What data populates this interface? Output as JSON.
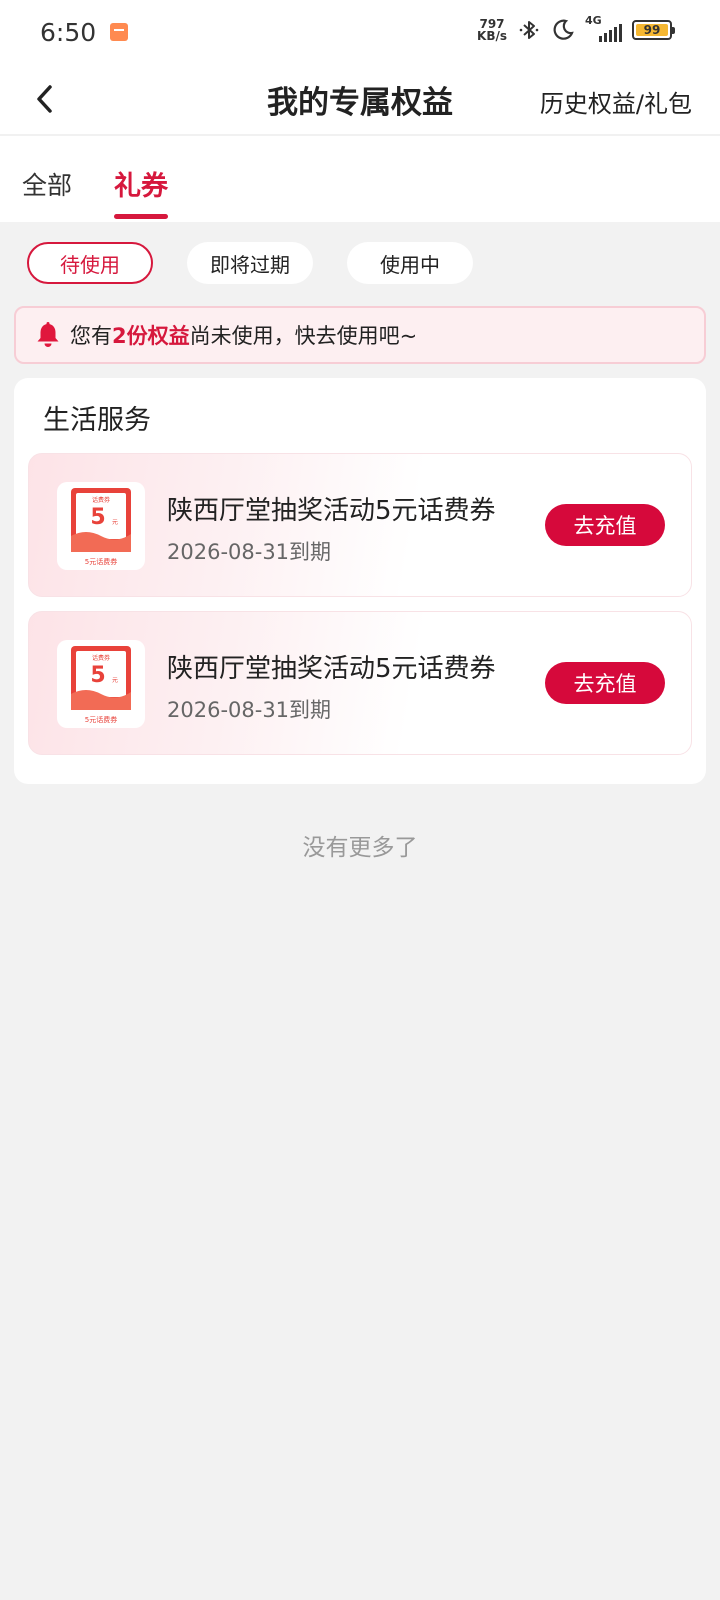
{
  "status_bar": {
    "time": "6:50",
    "net_speed_value": "797",
    "net_speed_unit": "KB/s",
    "signal_label": "4G",
    "battery": "99",
    "battery_level": 0.99,
    "icons": [
      "app-notification-icon",
      "bluetooth-icon",
      "moon-icon",
      "signal-icon",
      "battery-icon"
    ]
  },
  "header": {
    "title": "我的专属权益",
    "history_link": "历史权益/礼包",
    "back_icon": "chevron-left-icon"
  },
  "tabs": [
    {
      "label": "全部",
      "active": false
    },
    {
      "label": "礼券",
      "active": true
    }
  ],
  "filters": [
    {
      "label": "待使用",
      "active": true
    },
    {
      "label": "即将过期",
      "active": false
    },
    {
      "label": "使用中",
      "active": false
    }
  ],
  "notice": {
    "prefix": "您有",
    "highlight": "2份权益",
    "suffix": "尚未使用，快去使用吧~",
    "icon": "bell-icon"
  },
  "section": {
    "title": "生活服务",
    "coupons": [
      {
        "name": "陕西厅堂抽奖活动5元话费券",
        "expiry": "2026-08-31到期",
        "button": "去充值",
        "thumb": {
          "top": "话费券",
          "amount": "5",
          "unit": "元",
          "caption": "5元话费券"
        }
      },
      {
        "name": "陕西厅堂抽奖活动5元话费券",
        "expiry": "2026-08-31到期",
        "button": "去充值",
        "thumb": {
          "top": "话费券",
          "amount": "5",
          "unit": "元",
          "caption": "5元话费券"
        }
      }
    ]
  },
  "footer_text": "没有更多了",
  "colors": {
    "accent": "#d6183d",
    "button": "#d6093b",
    "background": "#f2f2f2"
  }
}
